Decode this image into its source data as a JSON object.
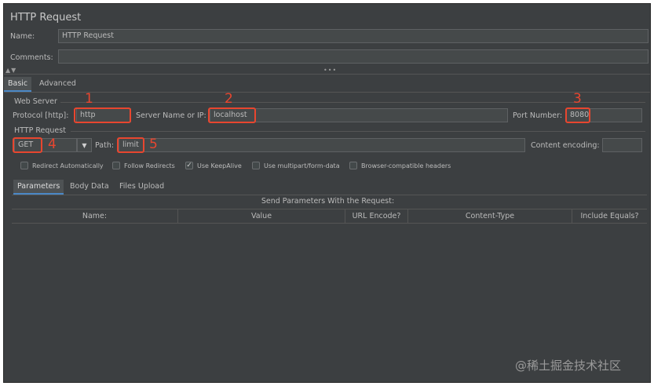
{
  "panel": {
    "title": "HTTP Request",
    "name_label": "Name:",
    "name_value": "HTTP Request",
    "comments_label": "Comments:",
    "comments_value": ""
  },
  "tabs": {
    "basic": "Basic",
    "advanced": "Advanced"
  },
  "web_server": {
    "section_label": "Web Server",
    "protocol_label": "Protocol [http]:",
    "protocol_value": "http",
    "server_label": "Server Name or IP:",
    "server_value": "localhost",
    "port_label": "Port Number:",
    "port_value": "8080"
  },
  "http_request": {
    "section_label": "HTTP Request",
    "method_value": "GET",
    "path_label": "Path:",
    "path_value": "limit",
    "encoding_label": "Content encoding:",
    "encoding_value": ""
  },
  "checkboxes": [
    {
      "label": "Redirect Automatically",
      "checked": false
    },
    {
      "label": "Follow Redirects",
      "checked": false
    },
    {
      "label": "Use KeepAlive",
      "checked": true
    },
    {
      "label": "Use multipart/form-data",
      "checked": false
    },
    {
      "label": "Browser-compatible headers",
      "checked": false
    }
  ],
  "subtabs": {
    "parameters": "Parameters",
    "body_data": "Body Data",
    "files_upload": "Files Upload"
  },
  "params_table": {
    "caption": "Send Parameters With the Request:",
    "columns": [
      "Name:",
      "Value",
      "URL Encode?",
      "Content-Type",
      "Include Equals?"
    ]
  },
  "annotations": [
    "1",
    "2",
    "3",
    "4",
    "5"
  ],
  "watermark": "@稀土掘金技术社区",
  "colors": {
    "annotation": "#e8462f",
    "background": "#3c3f41",
    "field": "#45494a"
  }
}
